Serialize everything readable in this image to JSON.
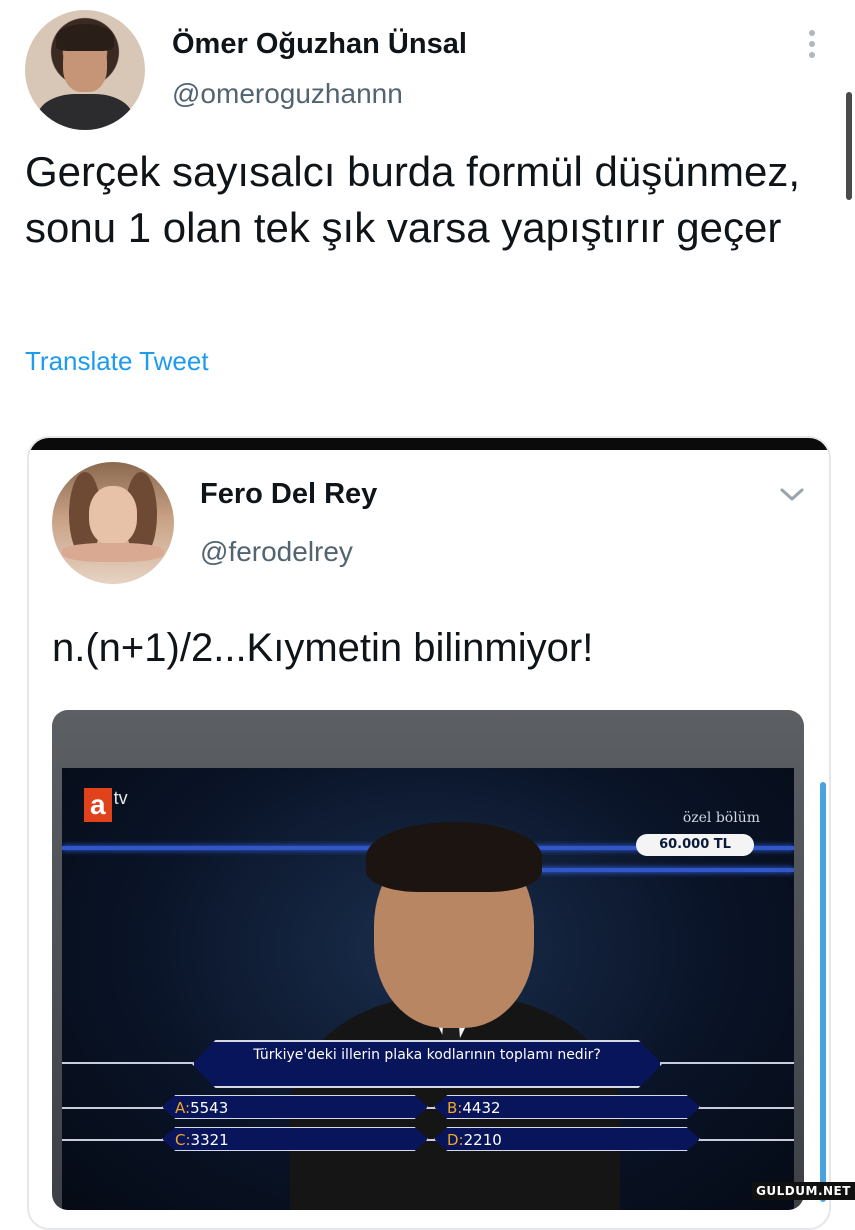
{
  "outer_tweet": {
    "author_name": "Ömer Oğuzhan Ünsal",
    "author_handle": "@omeroguzhannn",
    "text": "Gerçek sayısalcı burda formül düşünmez, sonu 1 olan tek şık varsa yapıştırır geçer",
    "translate_label": "Translate Tweet",
    "more_icon": "more-vertical-icon"
  },
  "quoted_tweet": {
    "author_name": "Fero Del Rey",
    "author_handle": "@ferodelrey",
    "text": "n.(n+1)/2...Kıymetin bilinmiyor!",
    "menu_icon": "chevron-down-icon"
  },
  "tv_screen": {
    "channel_logo_a": "a",
    "channel_logo_tv": "tv",
    "special_label": "özel bölüm",
    "prize": "60.000 TL",
    "question": "Türkiye'deki illerin plaka kodlarının toplamı nedir?",
    "answers": [
      {
        "key": "A:",
        "value": "5543"
      },
      {
        "key": "B:",
        "value": "4432"
      },
      {
        "key": "C:",
        "value": "3321"
      },
      {
        "key": "D:",
        "value": "2210"
      }
    ]
  },
  "watermark": "GULDUM.NET",
  "colors": {
    "link": "#1d9bf0",
    "handle": "#536471",
    "text": "#0f1419",
    "answer_key": "#f5a623",
    "question_box": "#08155a"
  }
}
